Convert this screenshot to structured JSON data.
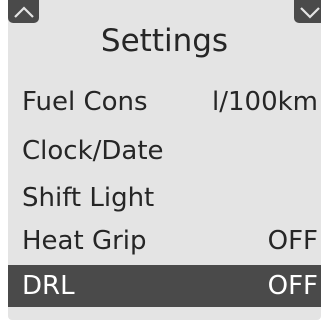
{
  "header": {
    "title": "Settings",
    "up_icon": "chevron-up-icon",
    "down_icon": "chevron-down-icon"
  },
  "menu": {
    "items": [
      {
        "label": "Fuel Cons",
        "value": "l/100km",
        "selected": false
      },
      {
        "label": "Clock/Date",
        "value": "",
        "selected": false
      },
      {
        "label": "Shift Light",
        "value": "",
        "selected": false
      },
      {
        "label": "Heat Grip",
        "value": "OFF",
        "selected": false
      },
      {
        "label": "DRL",
        "value": "OFF",
        "selected": true
      }
    ]
  },
  "colors": {
    "screen_background": "#e4e4e4",
    "highlight": "#4a4a4a",
    "text": "#262626",
    "highlight_text": "#ffffff"
  }
}
